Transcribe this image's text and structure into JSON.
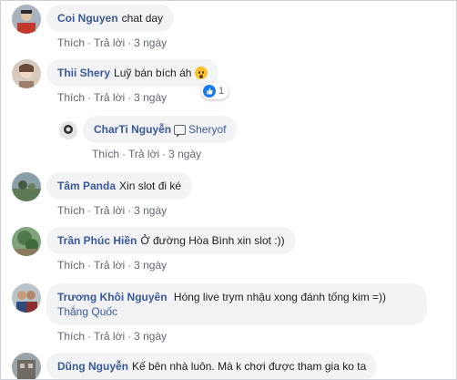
{
  "comments": [
    {
      "author": "Coi Nguyen",
      "text": "chat day",
      "actions": {
        "like": "Thích",
        "reply": "Trả lời",
        "time": "3 ngày"
      }
    },
    {
      "author": "Thii Shery",
      "text": "Luỹ bán bích áh",
      "reaction_count": "1",
      "actions": {
        "like": "Thích",
        "reply": "Trả lời",
        "time": "3 ngày"
      }
    },
    {
      "author": "CharTi Nguyễn",
      "mention": "Sheryof",
      "actions": {
        "like": "Thích",
        "reply": "Trả lời",
        "time": "3 ngày"
      }
    },
    {
      "author": "Tâm Panda",
      "text": "Xin slot đi ké",
      "actions": {
        "like": "Thích",
        "reply": "Trả lời",
        "time": "3 ngày"
      }
    },
    {
      "author": "Trần Phúc Hiền",
      "text": "Ở đường Hòa Bình xin slot :))",
      "actions": {
        "like": "Thích",
        "reply": "Trả lời",
        "time": "3 ngày"
      }
    },
    {
      "author": "Trương Khôi Nguyên",
      "text": "Hóng live trym nhậu xong đánh tống kim =))",
      "mention": "Thắng Quốc",
      "actions": {
        "like": "Thích",
        "reply": "Trả lời",
        "time": "3 ngày"
      }
    },
    {
      "author": "Dũng Nguyễn",
      "text": "Kế bên nhà luôn. Mà k chơi được tham gia ko ta"
    }
  ],
  "colors": {
    "author": "#385898",
    "bubble": "#f2f3f5",
    "meta": "#606770",
    "like_blue": "#1877f2"
  }
}
